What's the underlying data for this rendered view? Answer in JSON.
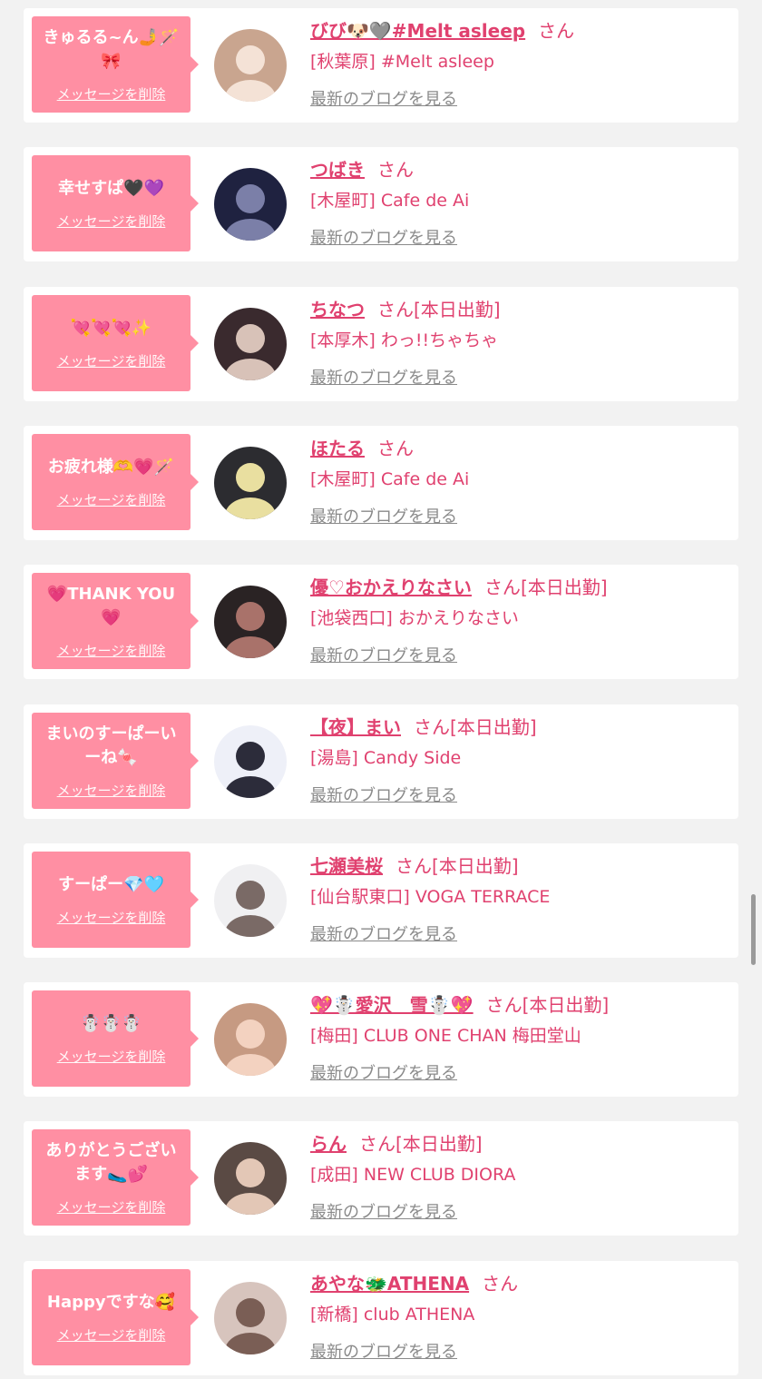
{
  "delete_label": "メッセージを削除",
  "blog_label": "最新のブログを見る",
  "san_label": "さん",
  "colors": {
    "accent": "#e0416f",
    "bubble": "#ff8fa3",
    "background": "#f2f2f2",
    "link_gray": "#8a8a8a"
  },
  "messages": [
    {
      "message": "きゅるる~ん🤳🪄🎀",
      "name": "びび🐶🩶#Melt asleep",
      "badge": "",
      "location": "[秋葉原] #Melt asleep"
    },
    {
      "message": "幸せすぱ🖤💜",
      "name": "つばき",
      "badge": "",
      "location": "[木屋町] Cafe de Ai"
    },
    {
      "message": "💘💘💘✨",
      "name": "ちなつ",
      "badge": "[本日出勤]",
      "location": "[本厚木] わっ!!ちゃちゃ"
    },
    {
      "message": "お疲れ様🫶💗🪄",
      "name": "ほたる",
      "badge": "",
      "location": "[木屋町] Cafe de Ai"
    },
    {
      "message": "💗THANK YOU💗",
      "name": "優♡おかえりなさい",
      "badge": "[本日出勤]",
      "location": "[池袋西口] おかえりなさい"
    },
    {
      "message": "まいのすーぱーいーね🍬",
      "name": "【夜】まい",
      "badge": "[本日出勤]",
      "location": "[湯島] Candy Side"
    },
    {
      "message": "すーぱー💎🩵",
      "name": "七瀬美桜",
      "badge": "[本日出勤]",
      "location": "[仙台駅東口] VOGA TERRACE"
    },
    {
      "message": "☃️☃️☃️",
      "name": "💖☃️愛沢＿雪☃️💖",
      "badge": "[本日出勤]",
      "location": "[梅田] CLUB ONE CHAN 梅田堂山"
    },
    {
      "message": "ありがとうございます🥿💕",
      "name": "らん",
      "badge": "[本日出勤]",
      "location": "[成田] NEW CLUB DIORA"
    },
    {
      "message": "Happyですな🥰",
      "name": "あやな🐲ATHENA",
      "badge": "",
      "location": "[新橋] club ATHENA"
    }
  ]
}
